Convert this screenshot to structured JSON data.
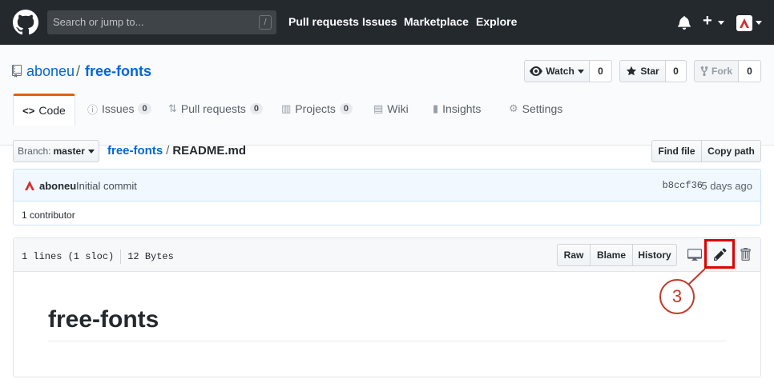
{
  "topnav": {
    "search_placeholder": "Search or jump to...",
    "search_shortcut": "/",
    "links": [
      "Pull requests",
      "Issues",
      "Marketplace",
      "Explore"
    ],
    "plus": "+"
  },
  "repo": {
    "owner": "aboneu",
    "separator": "/",
    "name": "free-fonts",
    "watch_label": "Watch",
    "watch_count": "0",
    "star_label": "Star",
    "star_count": "0",
    "fork_label": "Fork",
    "fork_count": "0"
  },
  "tabs": [
    {
      "label": "Code",
      "icon": "code-icon"
    },
    {
      "label": "Issues",
      "counter": "0",
      "icon": "issue-icon"
    },
    {
      "label": "Pull requests",
      "counter": "0",
      "icon": "pull-request-icon"
    },
    {
      "label": "Projects",
      "counter": "0",
      "icon": "project-icon"
    },
    {
      "label": "Wiki",
      "icon": "book-icon"
    },
    {
      "label": "Insights",
      "icon": "graph-icon"
    },
    {
      "label": "Settings",
      "icon": "gear-icon"
    }
  ],
  "breadcrumb": {
    "branch_prefix": "Branch:",
    "branch": "master",
    "repo_link": "free-fonts",
    "separator": "/",
    "file": "README.md",
    "find_file": "Find file",
    "copy_path": "Copy path"
  },
  "commit": {
    "author": "aboneu",
    "message": "Initial commit",
    "sha": "b8ccf36",
    "time": "5 days ago",
    "contributors": "1 contributor"
  },
  "file": {
    "lines": "1 lines (1 sloc)",
    "size": "12 Bytes",
    "raw": "Raw",
    "blame": "Blame",
    "history": "History"
  },
  "callout": {
    "number": "3"
  },
  "readme": {
    "title": "free-fonts"
  },
  "colors": {
    "accent": "#e36209",
    "link": "#0366d6",
    "highlight": "#e00000"
  }
}
